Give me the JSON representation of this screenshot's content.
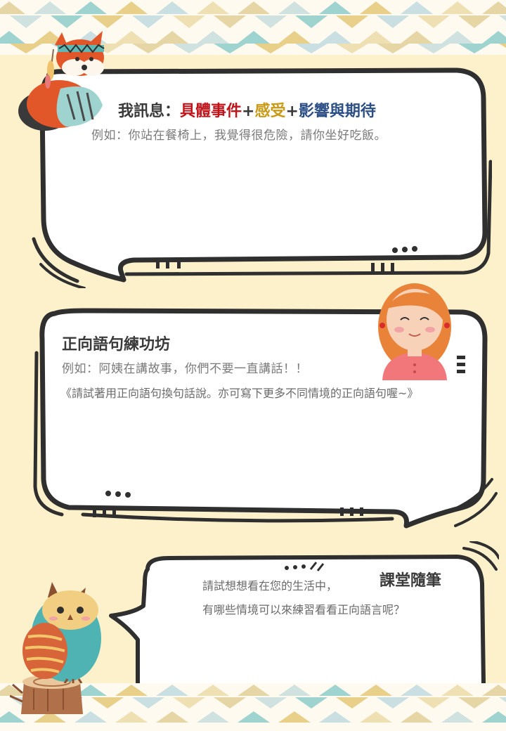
{
  "section1": {
    "title_prefix": "我訊息：",
    "part1": "具體事件",
    "plus1": "+",
    "part2": "感受",
    "plus2": "+",
    "part3": "影響與期待",
    "example": "例如：你站在餐椅上，我覺得很危險，請你坐好吃飯。"
  },
  "section2": {
    "title": "正向語句練功坊",
    "example": "例如：阿姨在講故事，你們不要一直講話！！",
    "instruction": "《請試著用正向語句換句話說。亦可寫下更多不同情境的正向語句喔~》"
  },
  "section3": {
    "title": "課堂隨筆",
    "line1": "請試想想看在您的生活中，",
    "line2": "有哪些情境可以來練習看看正向語言呢？"
  },
  "colors": {
    "background": "#fdf1cc",
    "red": "#c0141b",
    "gold": "#c89a16",
    "blue": "#2c4f86"
  },
  "icons": [
    "fox-icon",
    "girl-icon",
    "owl-icon",
    "tree-stump-icon"
  ]
}
